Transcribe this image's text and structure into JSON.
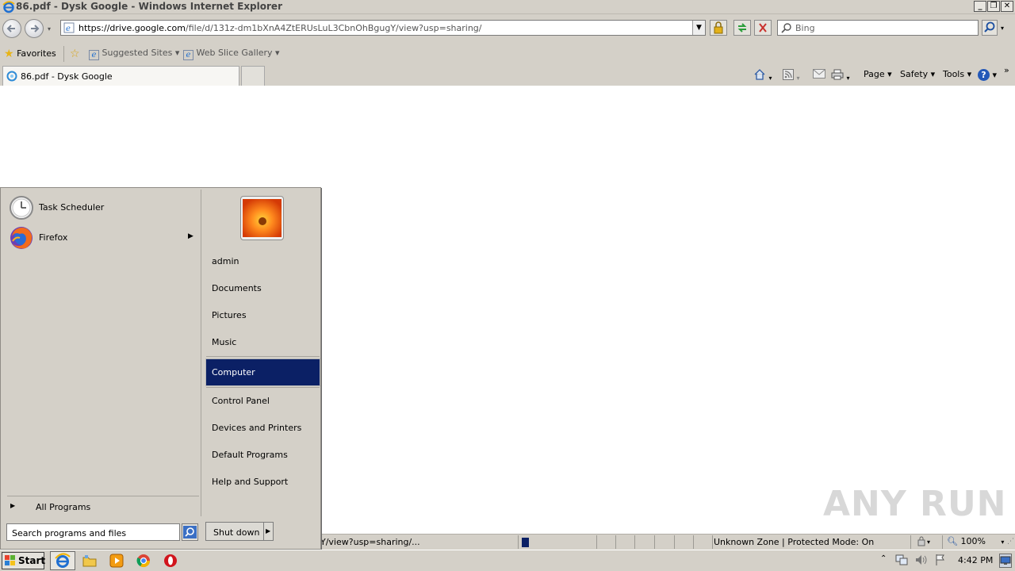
{
  "window": {
    "title": "86.pdf - Dysk Google - Windows Internet Explorer"
  },
  "address_bar": {
    "url_prefix": "https://drive.",
    "url_domain": "google.com",
    "url_rest": "/file/d/131z-dm1bXnA4ZtERUsLuL3CbnOhBgugY/view?usp=sharing/"
  },
  "search_box": {
    "placeholder": "Bing"
  },
  "favorites_bar": {
    "favorites_label": "Favorites",
    "suggested_sites": "Suggested Sites",
    "web_slice_gallery": "Web Slice Gallery"
  },
  "tabs": [
    {
      "label": "86.pdf - Dysk Google"
    }
  ],
  "command_bar": {
    "page": "Page",
    "safety": "Safety",
    "tools": "Tools"
  },
  "start_menu": {
    "programs": [
      {
        "label": "Task Scheduler",
        "icon": "clock-icon"
      },
      {
        "label": "Firefox",
        "icon": "firefox-icon",
        "has_submenu": true
      }
    ],
    "all_programs": "All Programs",
    "search_placeholder": "Search programs and files",
    "right_items": [
      {
        "label": "admin"
      },
      {
        "label": "Documents"
      },
      {
        "label": "Pictures"
      },
      {
        "label": "Music"
      },
      {
        "label": "Computer",
        "selected": true
      },
      {
        "label": "Control Panel"
      },
      {
        "label": "Devices and Printers"
      },
      {
        "label": "Default Programs"
      },
      {
        "label": "Help and Support"
      }
    ],
    "shutdown_label": "Shut down"
  },
  "status_bar": {
    "url_text": "Y/view?usp=sharing/...",
    "zone_text": "Unknown Zone | Protected Mode: On",
    "zoom_text": "100%"
  },
  "taskbar": {
    "start_label": "Start",
    "clock": "4:42 PM"
  },
  "watermark": "ANY RUN",
  "colors": {
    "chrome": "#d4d0c8",
    "selection": "#0b2065"
  }
}
